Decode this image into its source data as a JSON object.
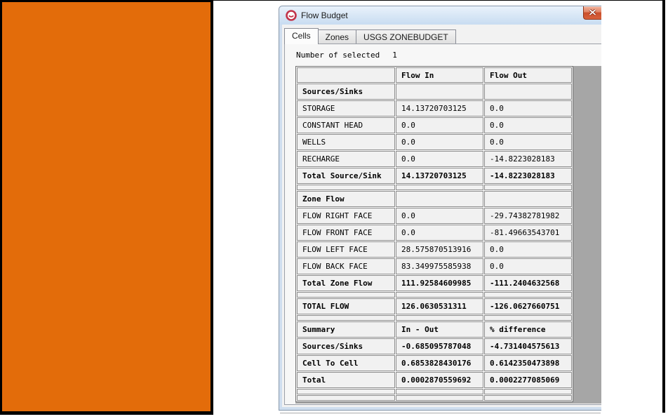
{
  "colors": {
    "orange_panel": "#E36C0A",
    "grid_outside": "#A6A6A6",
    "cell_bg": "#F1F1F1",
    "titlebar_top": "#E9F2FB",
    "titlebar_bottom": "#C8DCF1",
    "close_top": "#F2B19A",
    "close_bottom": "#C94F2B"
  },
  "window": {
    "title": "Flow Budget",
    "app_icon": "modelmuse-icon",
    "close_icon": "close-icon"
  },
  "tabs": [
    {
      "label": "Cells",
      "active": true
    },
    {
      "label": "Zones",
      "active": false
    },
    {
      "label": "USGS ZONEBUDGET",
      "active": false
    }
  ],
  "selection_info": {
    "label": "Number of selected",
    "value": "1"
  },
  "table": {
    "columns": [
      "",
      "Flow In",
      "Flow Out"
    ],
    "rows": [
      {
        "label": "Sources/Sinks",
        "in": "",
        "out": "",
        "bold": true
      },
      {
        "label": "STORAGE",
        "in": "14.13720703125",
        "out": "0.0"
      },
      {
        "label": "CONSTANT HEAD",
        "in": "0.0",
        "out": "0.0"
      },
      {
        "label": "WELLS",
        "in": "0.0",
        "out": "0.0"
      },
      {
        "label": "RECHARGE",
        "in": "0.0",
        "out": "-14.8223028183"
      },
      {
        "label": "Total Source/Sink",
        "in": "14.13720703125",
        "out": "-14.8223028183",
        "bold": true
      },
      {
        "thin": true
      },
      {
        "label": "Zone Flow",
        "in": "",
        "out": "",
        "bold": true
      },
      {
        "label": "FLOW RIGHT FACE",
        "in": "0.0",
        "out": "-29.74382781982"
      },
      {
        "label": "FLOW FRONT FACE",
        "in": "0.0",
        "out": "-81.49663543701"
      },
      {
        "label": "FLOW LEFT FACE",
        "in": "28.575870513916",
        "out": "0.0"
      },
      {
        "label": "FLOW BACK FACE",
        "in": "83.349975585938",
        "out": "0.0"
      },
      {
        "label": "Total Zone Flow",
        "in": "111.92584609985",
        "out": "-111.2404632568",
        "bold": true
      },
      {
        "thin": true
      },
      {
        "label": "TOTAL FLOW",
        "in": "126.0630531311",
        "out": "-126.0627660751",
        "bold": true
      },
      {
        "thin": true
      },
      {
        "label": "Summary",
        "in": "In - Out",
        "out": "% difference",
        "bold": true
      },
      {
        "label": "Sources/Sinks",
        "in": "-0.685095787048",
        "out": "-4.731404575613",
        "bold": true
      },
      {
        "label": "Cell To Cell",
        "in": "0.6853828430176",
        "out": "0.6142350473898",
        "bold": true
      },
      {
        "label": "Total",
        "in": "0.0002870559692",
        "out": "0.0002277085069",
        "bold": true
      },
      {
        "thin": true
      },
      {
        "thin": true
      }
    ]
  }
}
